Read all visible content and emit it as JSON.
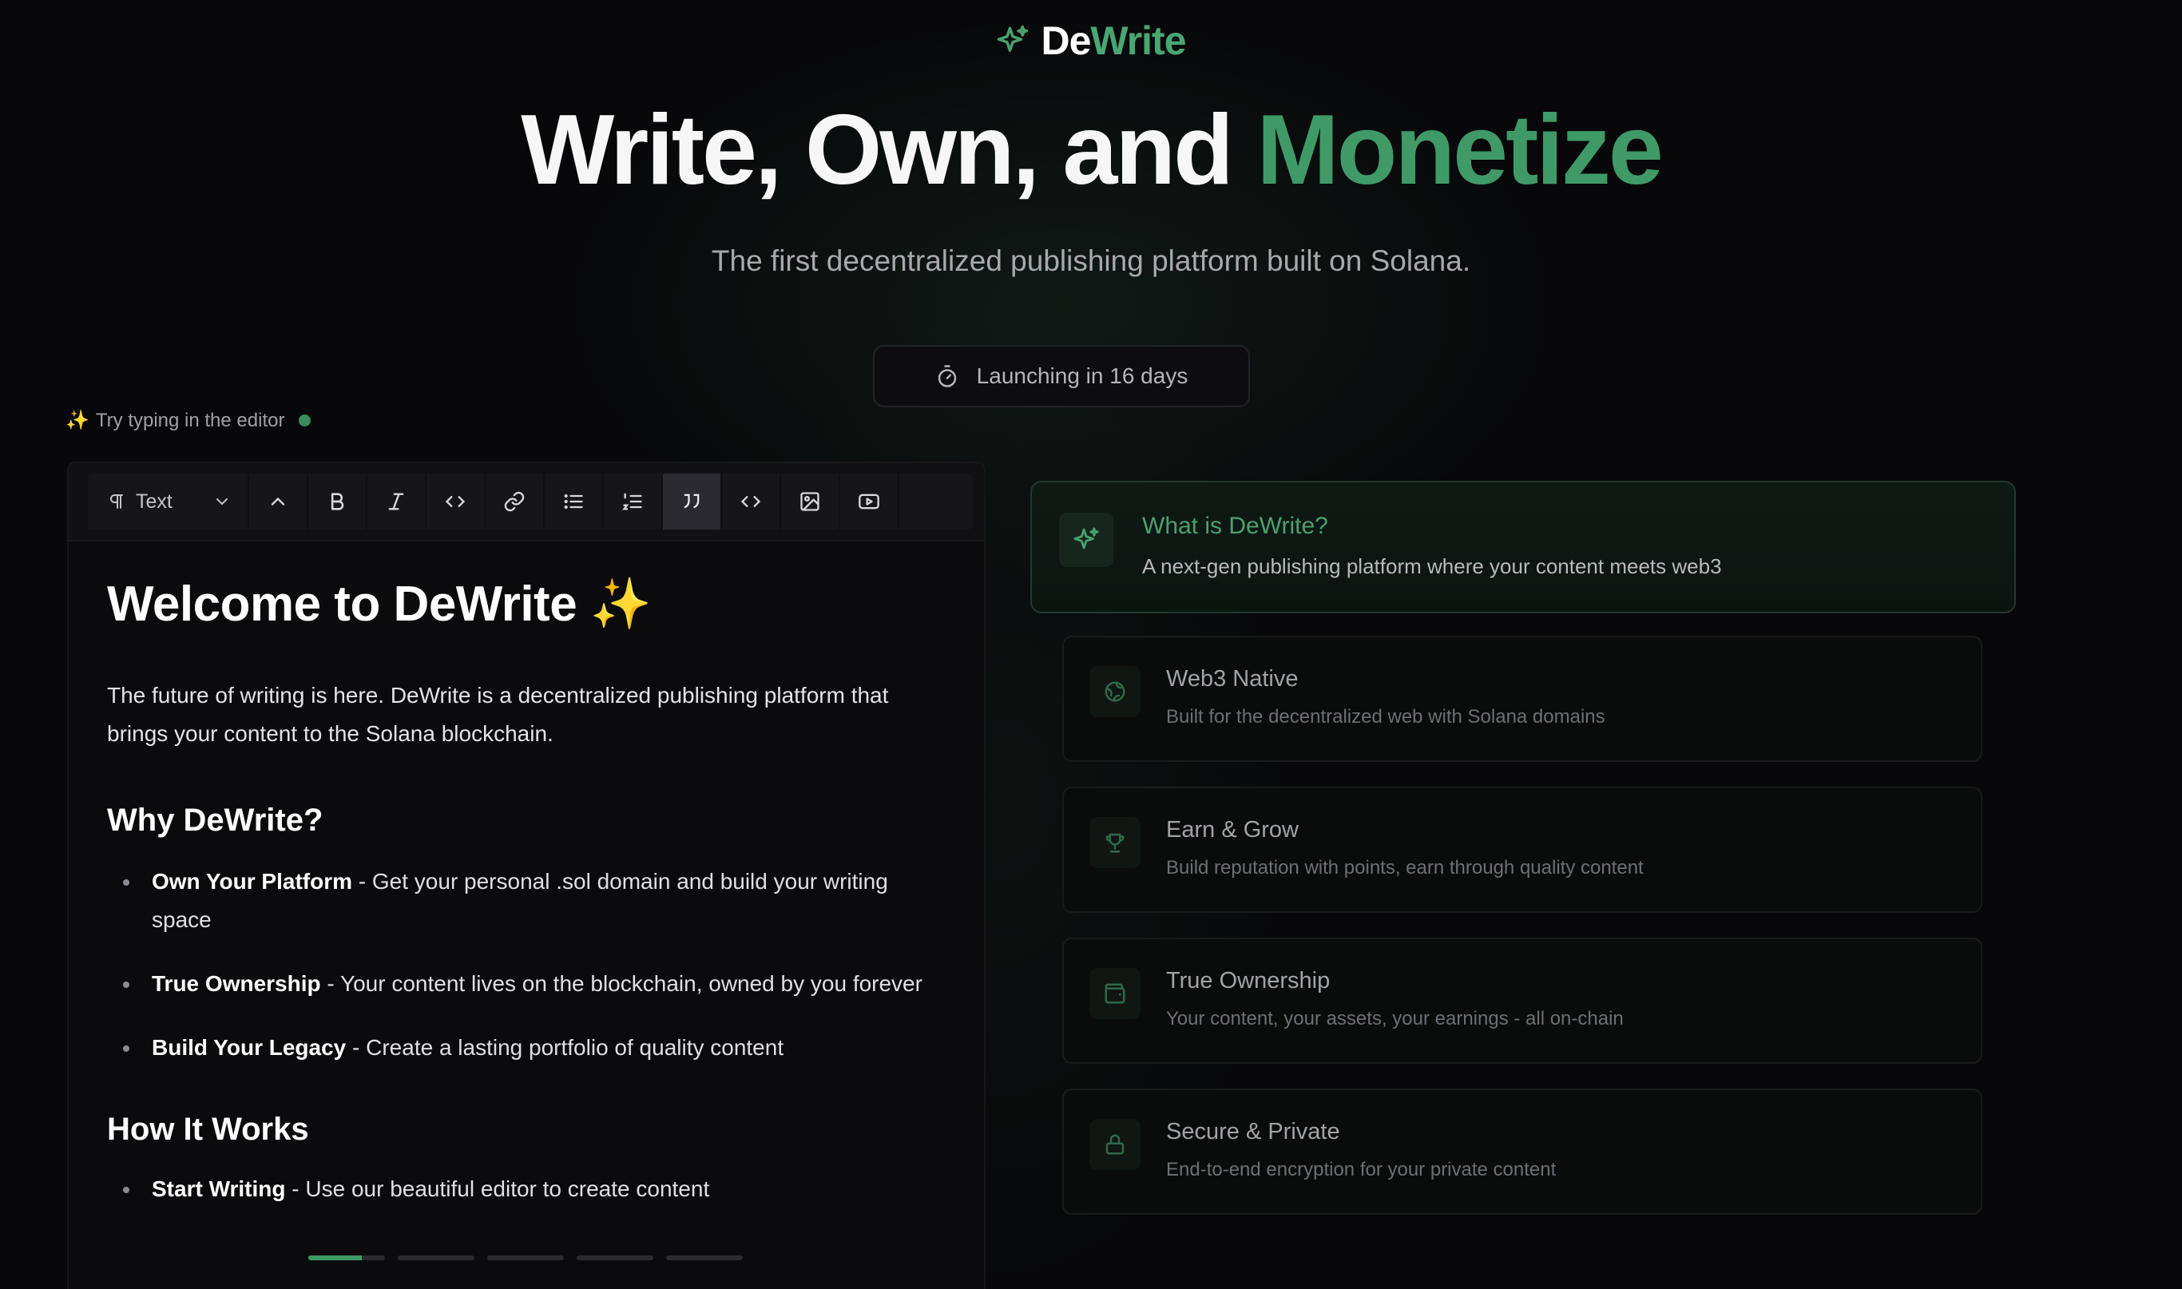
{
  "colors": {
    "accent": "#3f9a68",
    "background": "#08080a"
  },
  "logo": {
    "part1": "De",
    "part2": "Write",
    "icon": "sparkle-icon"
  },
  "hero": {
    "title_main": "Write, Own, and ",
    "title_accent": "Monetize",
    "subtitle": "The first decentralized publishing platform built on Solana.",
    "launch_label": "Launching in 16 days",
    "launch_icon": "timer-icon"
  },
  "editor": {
    "hint": "Try typing in the editor",
    "hint_icon": "✨",
    "toolbar": {
      "block_type": "Text",
      "tools": [
        "chevron-up-icon",
        "bold-icon",
        "italic-icon",
        "code-icon",
        "link-icon",
        "bullet-list-icon",
        "ordered-list-icon",
        "quote-icon",
        "code-block-icon",
        "image-icon",
        "video-icon"
      ],
      "active_tool": "quote-icon"
    },
    "doc": {
      "title": "Welcome to DeWrite ✨",
      "intro": "The future of writing is here. DeWrite is a decentralized publishing platform that brings your content to the Solana blockchain.",
      "section1": "Why DeWrite?",
      "why_items": [
        {
          "bold": "Own Your Platform",
          "text": " - Get your personal .sol domain and build your writing space"
        },
        {
          "bold": "True Ownership",
          "text": " - Your content lives on the blockchain, owned by you forever"
        },
        {
          "bold": "Build Your Legacy",
          "text": " - Create a lasting portfolio of quality content"
        }
      ],
      "section2": "How It Works",
      "how_items": [
        {
          "bold": "Start Writing",
          "text": " - Use our beautiful editor to create content"
        }
      ]
    },
    "progress": [
      0.7,
      0,
      0,
      0,
      0
    ]
  },
  "features": {
    "main": {
      "title": "What is DeWrite?",
      "desc": "A next-gen publishing platform where your content meets web3",
      "icon": "sparkle-icon"
    },
    "items": [
      {
        "title": "Web3 Native",
        "desc": "Built for the decentralized web with Solana domains",
        "icon": "globe-icon"
      },
      {
        "title": "Earn & Grow",
        "desc": "Build reputation with points, earn through quality content",
        "icon": "trophy-icon"
      },
      {
        "title": "True Ownership",
        "desc": "Your content, your assets, your earnings - all on-chain",
        "icon": "wallet-icon"
      },
      {
        "title": "Secure & Private",
        "desc": "End-to-end encryption for your private content",
        "icon": "lock-icon"
      }
    ]
  }
}
